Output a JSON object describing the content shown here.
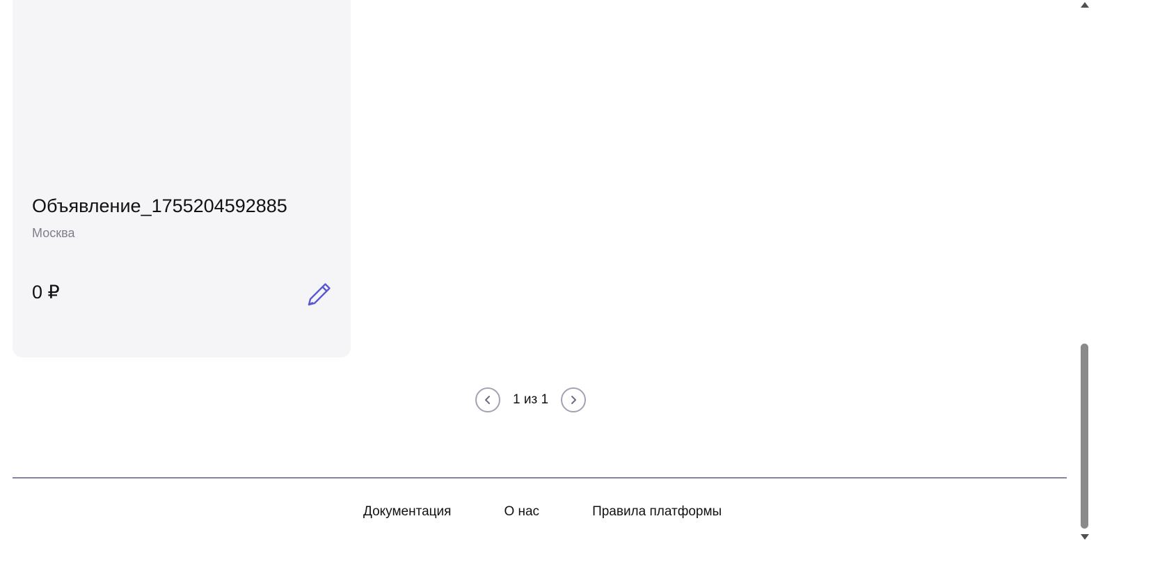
{
  "ad": {
    "title": "Объявление_1755204592885",
    "city": "Москва",
    "price": "0 ₽",
    "edit_icon": "pencil-icon",
    "accent_color": "#5b57d1"
  },
  "pagination": {
    "info": "1 из 1",
    "prev_icon": "chevron-left-icon",
    "next_icon": "chevron-right-icon"
  },
  "footer": {
    "links": [
      {
        "label": "Документация"
      },
      {
        "label": "О нас"
      },
      {
        "label": "Правила платформы"
      }
    ]
  },
  "colors": {
    "card_background": "#f5f5f7",
    "muted_text": "#7e7e8c",
    "divider": "#85849a",
    "pager_border": "#a3a2b3"
  }
}
